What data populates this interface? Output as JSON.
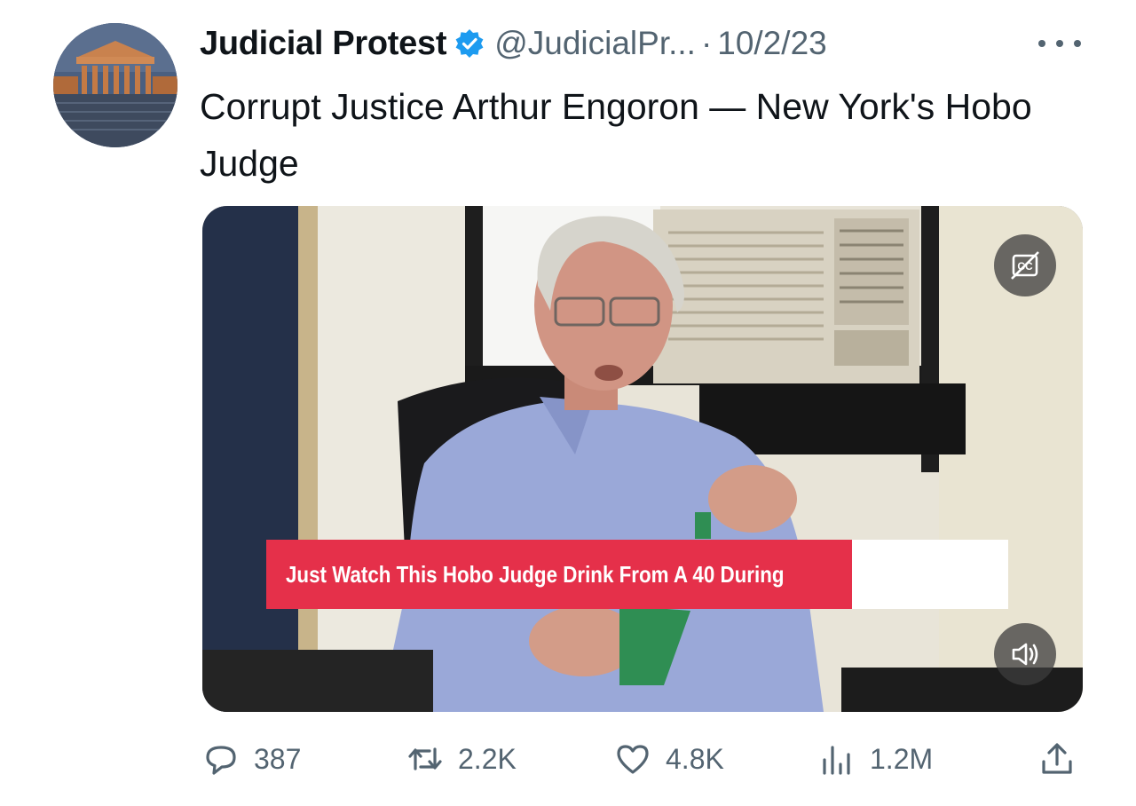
{
  "author": {
    "display_name": "Judicial Protest",
    "handle": "@JudicialPr...",
    "separator": "·",
    "date": "10/2/23",
    "verified": true
  },
  "tweet": {
    "text": "Corrupt Justice Arthur Engoron — New York's Hobo Judge"
  },
  "media": {
    "type": "video",
    "caption_overlay": "Just Watch This Hobo Judge Drink From A 40 During"
  },
  "actions": {
    "replies": "387",
    "reposts": "2.2K",
    "likes": "4.8K",
    "views": "1.2M"
  },
  "colors": {
    "verified_blue": "#1d9bf0",
    "text_primary": "#0f1419",
    "text_secondary": "#536471",
    "caption_red": "#e5304a"
  },
  "icons": [
    "verified-badge-icon",
    "more-icon",
    "captions-off-icon",
    "volume-icon",
    "reply-icon",
    "repost-icon",
    "like-icon",
    "views-icon",
    "share-icon"
  ]
}
